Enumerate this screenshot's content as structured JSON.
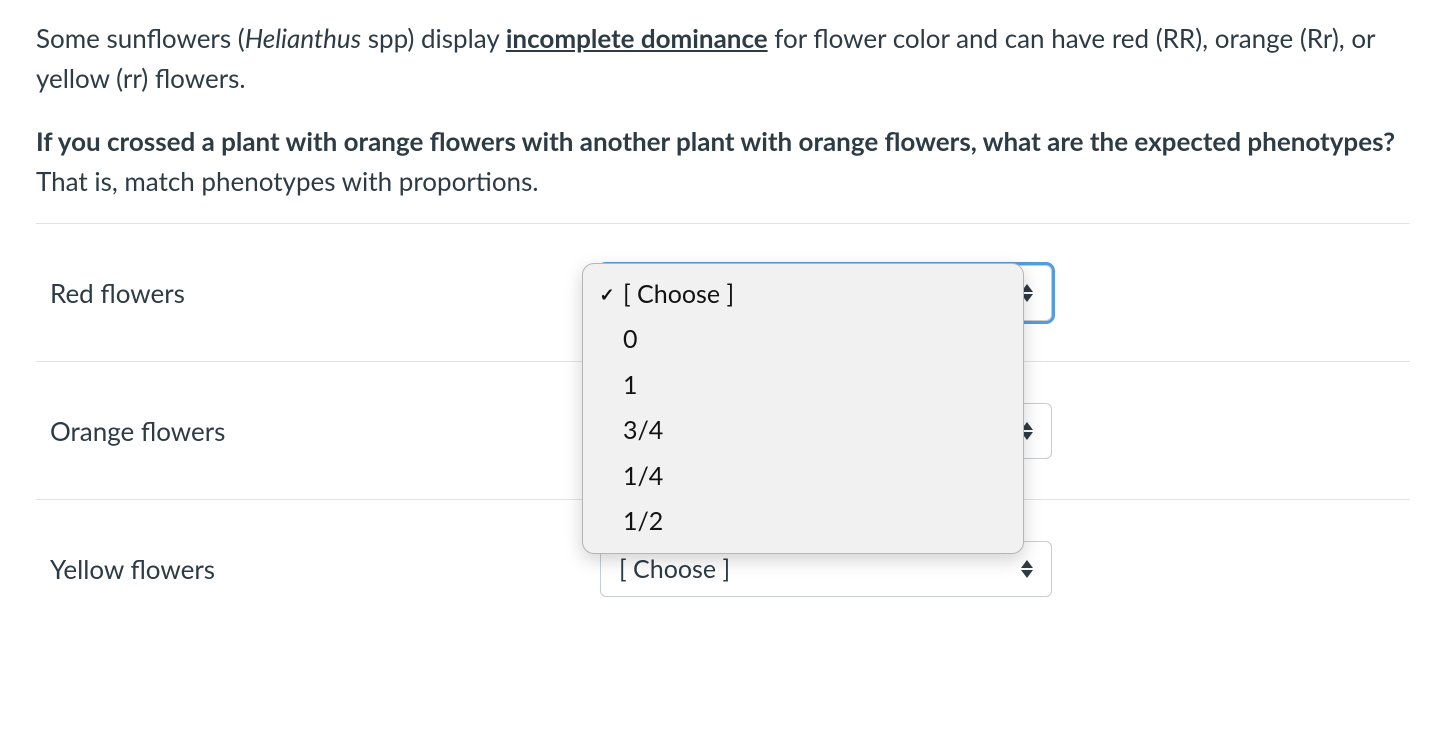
{
  "question": {
    "intro_parts": {
      "p1_a": "Some sunflowers (",
      "p1_italic": "Helianthus",
      "p1_b": " spp) display ",
      "p1_underline": "incomplete dominance",
      "p1_c": " for flower color and can have red (RR), orange (Rr), or yellow (rr) flowers.",
      "p2_bold": "If you crossed a plant with orange flowers with another plant with orange flowers, what are the expected phenotypes?",
      "p2_rest": "  That is, match phenotypes with proportions."
    }
  },
  "rows": [
    {
      "label": "Red flowers"
    },
    {
      "label": "Orange flowers"
    },
    {
      "label": "Yellow flowers"
    }
  ],
  "select_placeholder": "[ Choose ]",
  "dropdown_options": [
    {
      "text": "[ Choose ]",
      "selected": true
    },
    {
      "text": "0",
      "selected": false
    },
    {
      "text": "1",
      "selected": false
    },
    {
      "text": "3/4",
      "selected": false
    },
    {
      "text": "1/4",
      "selected": false
    },
    {
      "text": "1/2",
      "selected": false
    }
  ]
}
